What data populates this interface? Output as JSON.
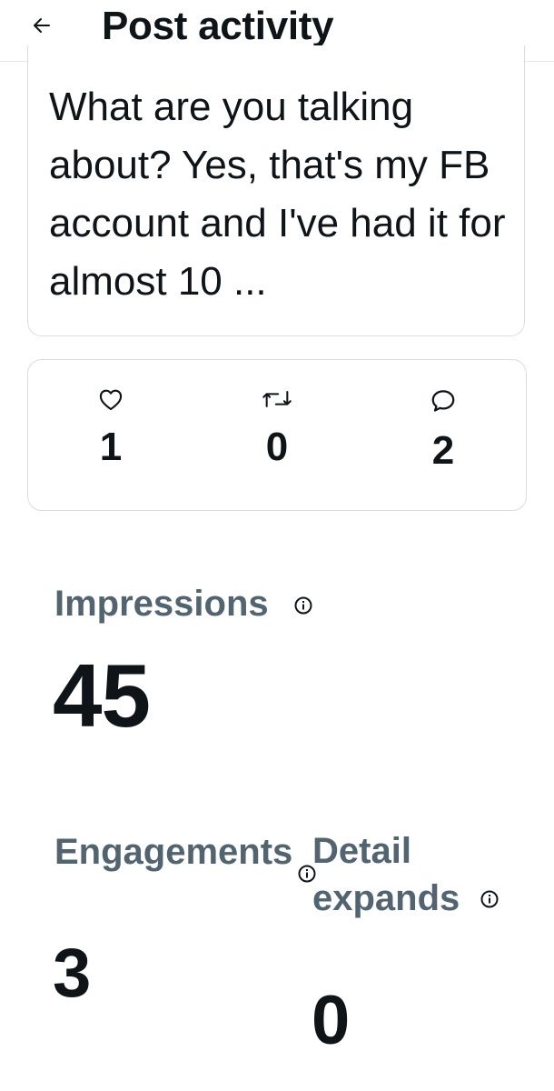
{
  "header": {
    "title": "Post activity",
    "back_icon": "back-arrow-icon"
  },
  "post": {
    "text": "What are you talking about? Yes, that's my FB account and I've had it for almost 10 ..."
  },
  "engagement_counts": {
    "likes": {
      "icon": "heart-icon",
      "value": "1"
    },
    "reposts": {
      "icon": "repost-icon",
      "value": "0"
    },
    "replies": {
      "icon": "reply-icon",
      "value": "2"
    }
  },
  "metrics": {
    "impressions": {
      "label": "Impressions",
      "value": "45",
      "info_icon": "info-icon"
    },
    "engagements": {
      "label": "Engagements",
      "value": "3",
      "info_icon": "info-icon"
    },
    "detail_expands": {
      "label": "Detail expands",
      "value": "0",
      "info_icon": "info-icon"
    }
  },
  "colors": {
    "primary_text": "#0f1419",
    "secondary_text": "#536471",
    "border": "#d9dde1"
  }
}
